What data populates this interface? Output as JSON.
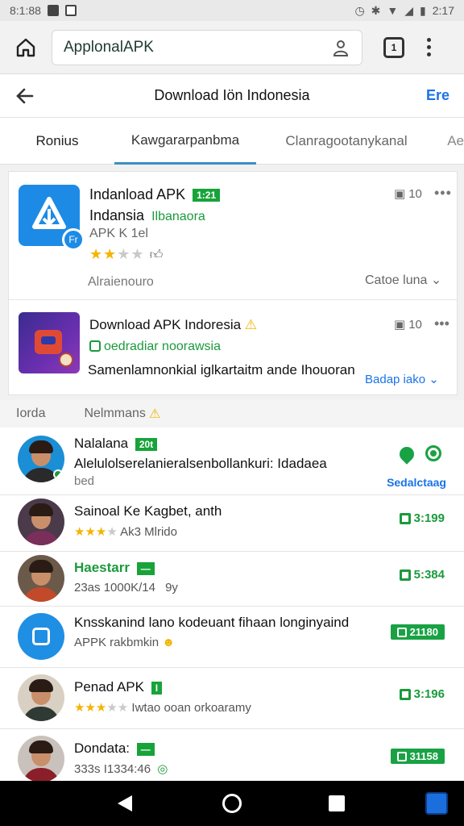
{
  "status_bar": {
    "time_left": "8:1:88",
    "time_right": "2:17"
  },
  "browser": {
    "url": "ApplonalAPK"
  },
  "page": {
    "title": "Download Iön Indonesia",
    "action": "Ere",
    "back_label": "←"
  },
  "tabs": [
    {
      "label": "Ronius"
    },
    {
      "label": "Kawgararpanbma"
    },
    {
      "label": "Clanragootanykanal"
    },
    {
      "label": "Ae"
    }
  ],
  "featured": [
    {
      "title": "Indanload APK",
      "tag": "1:21",
      "subtitle": "Indansia",
      "subtitle_green": "Ilbanaora",
      "version": "APK K 1el",
      "rating": 2,
      "meta": "Alraienouro",
      "count": "10",
      "action": "Catoe luna",
      "more": "•••",
      "badge": "Fr"
    },
    {
      "title": "Download APK Indoresia",
      "subtitle": "oedradiar noorawsia",
      "description": "Samenlamnonkial iglkartaitm ande Ihouoran",
      "count": "10",
      "action": "Badap iako",
      "more": "•••"
    }
  ],
  "section": {
    "label_1": "Iorda",
    "label_2": "Nelmmans"
  },
  "list": [
    {
      "title": "Nalalana",
      "tag": "20t",
      "description": "Alelulolserelanieralsenbollankuri: Idadaea",
      "extra": "bed",
      "action": "Sedalctaag"
    },
    {
      "title": "Sainoal Ke Kagbet, anth",
      "rating": 3,
      "sub": "Ak3 Mlrido",
      "count": "3:199"
    },
    {
      "title": "Haestarr",
      "sub": "23as 1000K/14",
      "extra": "9y",
      "count": "5:384"
    },
    {
      "title": "Knsskanind lano kodeuant fihaan longinyaind",
      "sub": "APPK rakbmkin",
      "count": "21180"
    },
    {
      "title": "Penad APK",
      "rating": 3,
      "sub": "Iwtao ooan orkoaramy",
      "count": "3:196"
    },
    {
      "title": "Dondata:",
      "sub": "333s I1334:46",
      "count": "31158"
    }
  ],
  "colors": {
    "accent": "#1a73e8",
    "green": "#19a244",
    "star": "#f5b400"
  },
  "icons": [
    "home-icon",
    "share-icon",
    "tabs-icon",
    "kebab-icon",
    "back-arrow-icon",
    "thumb-icon",
    "pin-icon",
    "gear-icon"
  ]
}
